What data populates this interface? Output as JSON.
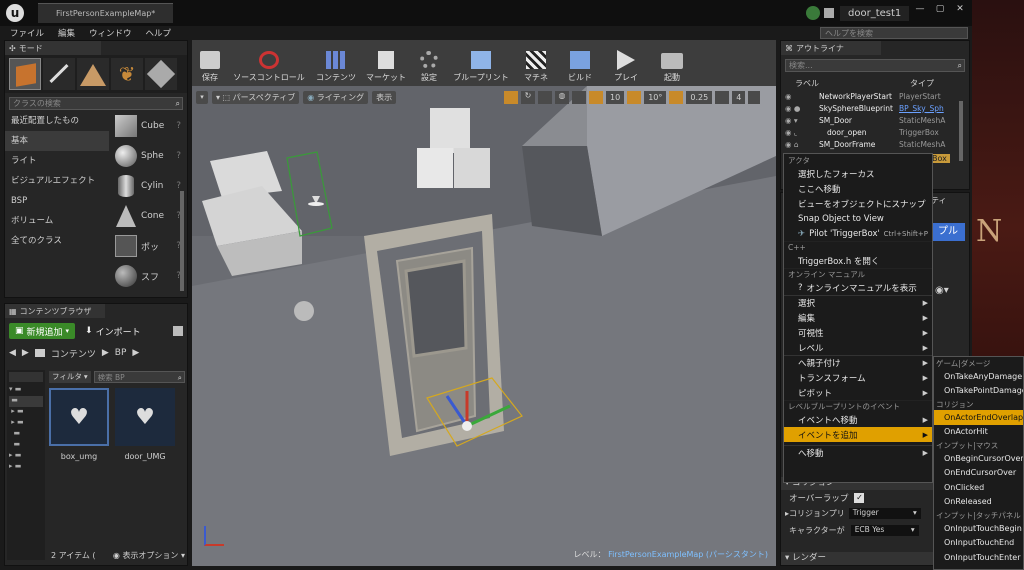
{
  "window": {
    "tab": "FirstPersonExampleMap*",
    "project": "door_test1",
    "help_placeholder": "ヘルプを検索"
  },
  "menu": [
    "ファイル",
    "編集",
    "ウィンドウ",
    "ヘルプ"
  ],
  "modes": {
    "title": "モード",
    "search_placeholder": "クラスの検索",
    "categories": [
      "最近配置したもの",
      "基本",
      "ライト",
      "ビジュアルエフェクト",
      "BSP",
      "ボリューム",
      "全てのクラス"
    ],
    "items": [
      "Cube",
      "Sphe",
      "Cylin",
      "Cone",
      "ポッ",
      "スフ"
    ]
  },
  "toolbar": {
    "buttons": [
      "保存",
      "ソースコントロール",
      "コンテンツ",
      "マーケット",
      "設定",
      "ブループリント",
      "マチネ",
      "ビルド",
      "プレイ",
      "起動"
    ]
  },
  "viewport": {
    "perspective": "パースペクティブ",
    "lighting": "ライティング",
    "show": "表示",
    "grid": "10",
    "rot": "10°",
    "scale": "0.25",
    "cam": "4",
    "level_label": "レベル：",
    "level_name": "FirstPersonExampleMap (パーシスタント)"
  },
  "content": {
    "title": "コンテンツブラウザ",
    "add_new": "新規追加",
    "import": "インポート",
    "path_root": "コンテンツ",
    "path_child": "BP",
    "filter": "フィルタ",
    "search_placeholder": "検索 BP",
    "assets": [
      "box_umg",
      "door_UMG"
    ],
    "count": "2 アイテム (",
    "view_opts": "表示オプション"
  },
  "outliner": {
    "title": "アウトライナ",
    "search_placeholder": "検索...",
    "col_label": "ラベル",
    "col_type": "タイプ",
    "rows": [
      {
        "name": "NetworkPlayerStart",
        "type": "PlayerStart"
      },
      {
        "name": "SkySphereBlueprint",
        "type": "BP_Sky_Sph"
      },
      {
        "name": "SM_Door",
        "type": "StaticMeshA"
      },
      {
        "name": "door_open",
        "type": "TriggerBox"
      },
      {
        "name": "SM_DoorFrame",
        "type": "StaticMeshA"
      }
    ],
    "sel_type": "Box"
  },
  "details": {
    "tab_frag": "ティ",
    "btn_frag": "プル",
    "collision_hdr": "コリジョン",
    "overlap_label": "オーバーラップ",
    "preset_label": "コリジョンプリ",
    "preset_value": "Trigger",
    "char_label": "キャラクターが",
    "char_value": "ECB Yes",
    "render_hdr": "レンダー"
  },
  "context": {
    "sections": {
      "actor": "アクタ",
      "cpp": "C++",
      "online": "オンライン マニュアル",
      "lbp": "レベルブループリントのイベント"
    },
    "items": {
      "focus": "選択したフォーカス",
      "move_here": "ここへ移動",
      "snap_view": "ビューをオブジェクトにスナップ",
      "snap_obj": "Snap Object to View",
      "pilot": "Pilot 'TriggerBox'",
      "pilot_key": "Ctrl+Shift+P",
      "open_h": "TriggerBox.h を開く",
      "manual": "オンラインマニュアルを表示",
      "select": "選択",
      "edit": "編集",
      "visibility": "可視性",
      "level": "レベル",
      "attach": "へ親子付け",
      "transform": "トランスフォーム",
      "pivot": "ピボット",
      "goto_event": "イベントへ移動",
      "add_event": "イベントを追加",
      "move_to": "へ移動"
    }
  },
  "submenu": {
    "sec1": "ゲーム|ダメージ",
    "damage": [
      "OnTakeAnyDamage",
      "OnTakePointDamage"
    ],
    "sec2": "コリジョン",
    "collision": [
      "OnActorEndOverlap",
      "OnActorHit"
    ],
    "sec3": "インプット|マウス",
    "mouse": [
      "OnBeginCursorOver",
      "OnEndCursorOver",
      "OnClicked",
      "OnReleased"
    ],
    "sec4": "インプット|タッチパネル",
    "touch": [
      "OnInputTouchBegin",
      "OnInputTouchEnd",
      "OnInputTouchEnter"
    ]
  },
  "bg_text": "N I",
  "colors": {
    "highlight": "#e0a000",
    "accent": "#3b6fd0"
  }
}
